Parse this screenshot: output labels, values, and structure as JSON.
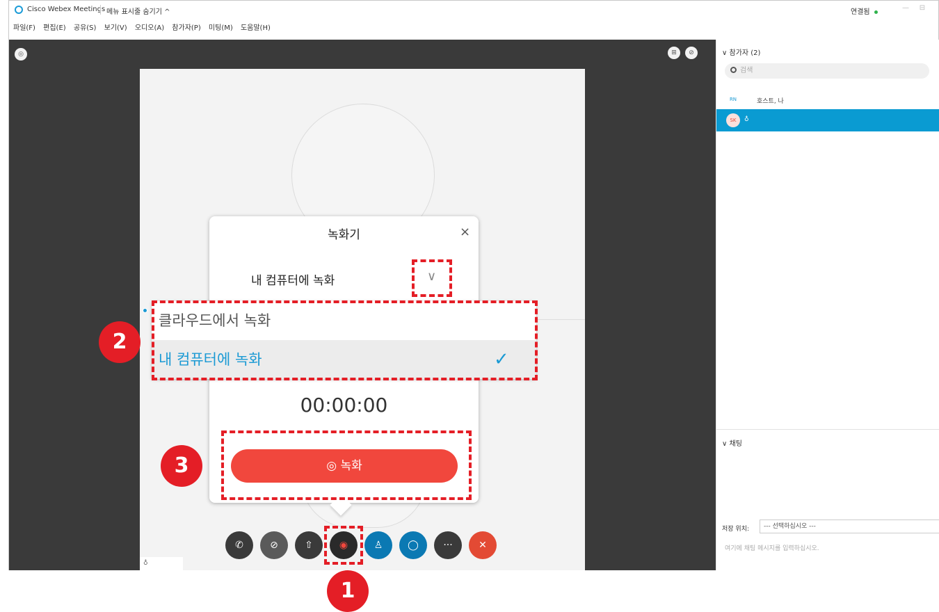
{
  "window": {
    "app_title": "Cisco Webex Meetings",
    "hide_menu": "메뉴 표시줄 숨기기 ^",
    "connection": "연결됨",
    "minimize": "—",
    "restore": "⊟"
  },
  "menubar": {
    "items": [
      "파일(F)",
      "편집(E)",
      "공유(S)",
      "보기(V)",
      "오디오(A)",
      "참가자(P)",
      "미팅(M)",
      "도움말(H)"
    ]
  },
  "sidebar": {
    "participants_title": "∨ 참가자 (2)",
    "search_placeholder": "검색",
    "participants": [
      {
        "initials": "RN",
        "label": "호스트, 나"
      },
      {
        "initials": "SK",
        "label": ""
      }
    ],
    "chat_title": "∨ 채팅",
    "save_label": "저장 위치:",
    "save_value": "--- 선택하십시오 ---",
    "chat_placeholder": "여기에 채팅 메시지를 입력하십시오."
  },
  "recorder": {
    "title": "녹화기",
    "close": "×",
    "selected": "내 컴퓨터에 녹화",
    "chevron": "∨",
    "options": [
      "클라우드에서 녹화",
      "내 컴퓨터에 녹화"
    ],
    "check": "✓",
    "timer": "00:00:00",
    "record_button": "◎ 녹화"
  },
  "toolbar": {
    "buttons": [
      {
        "icon": "phone-icon",
        "glyph": "✆",
        "color": "#3a3a3a"
      },
      {
        "icon": "video-off-icon",
        "glyph": "⊘",
        "color": "#5a5a5a"
      },
      {
        "icon": "share-icon",
        "glyph": "⇧",
        "color": "#3a3a3a"
      },
      {
        "icon": "record-icon",
        "glyph": "◉",
        "color": "#2a2a2a"
      },
      {
        "icon": "participants-icon",
        "glyph": "♙",
        "color": "#0b79b3"
      },
      {
        "icon": "chat-icon",
        "glyph": "◯",
        "color": "#0b79b3"
      },
      {
        "icon": "more-icon",
        "glyph": "···",
        "color": "#3a3a3a"
      },
      {
        "icon": "end-meeting-icon",
        "glyph": "✕",
        "color": "#e34a34"
      }
    ]
  },
  "annotations": {
    "step1": "1",
    "step2": "2",
    "step3": "3"
  },
  "colors": {
    "accent": "#1b9ad4",
    "record": "#f1473d",
    "annotation": "#e41e26",
    "selected_row": "#0a9bd2"
  }
}
